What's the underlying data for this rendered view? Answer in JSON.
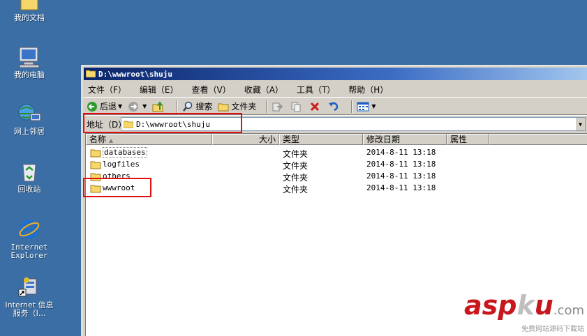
{
  "desktop": {
    "icons": [
      {
        "label": "我的文档"
      },
      {
        "label": "我的电脑"
      },
      {
        "label": "网上邻居"
      },
      {
        "label": "回收站"
      },
      {
        "label": "Internet Explorer"
      },
      {
        "label": "Internet 信息服务（I..."
      }
    ]
  },
  "window": {
    "title": "D:\\wwwroot\\shuju",
    "menu": [
      "文件（F）",
      "编辑（E）",
      "查看（V）",
      "收藏（A）",
      "工具（T）",
      "帮助（H）"
    ],
    "toolbar": {
      "back": "后退",
      "search": "搜索",
      "folders": "文件夹"
    },
    "address": {
      "label": "地址（D）",
      "value": "D:\\wwwroot\\shuju"
    },
    "columns": {
      "name": "名称",
      "size": "大小",
      "type": "类型",
      "modified": "修改日期",
      "attributes": "属性"
    },
    "files": [
      {
        "name": "databases",
        "type": "文件夹",
        "modified": "2014-8-11  13:18"
      },
      {
        "name": "logfiles",
        "type": "文件夹",
        "modified": "2014-8-11  13:18"
      },
      {
        "name": "others",
        "type": "文件夹",
        "modified": "2014-8-11  13:18"
      },
      {
        "name": "wwwroot",
        "type": "文件夹",
        "modified": "2014-8-11  13:18"
      }
    ]
  },
  "watermark": {
    "asp": "asp",
    "k": "k",
    "u": "u",
    "tld": ".com",
    "sub": "免费网站源码下载站"
  },
  "colors": {
    "desktop": "#3a6ea5",
    "highlight": "#e01010",
    "folder": "#f6d76b",
    "watermark": "#c8161d"
  }
}
